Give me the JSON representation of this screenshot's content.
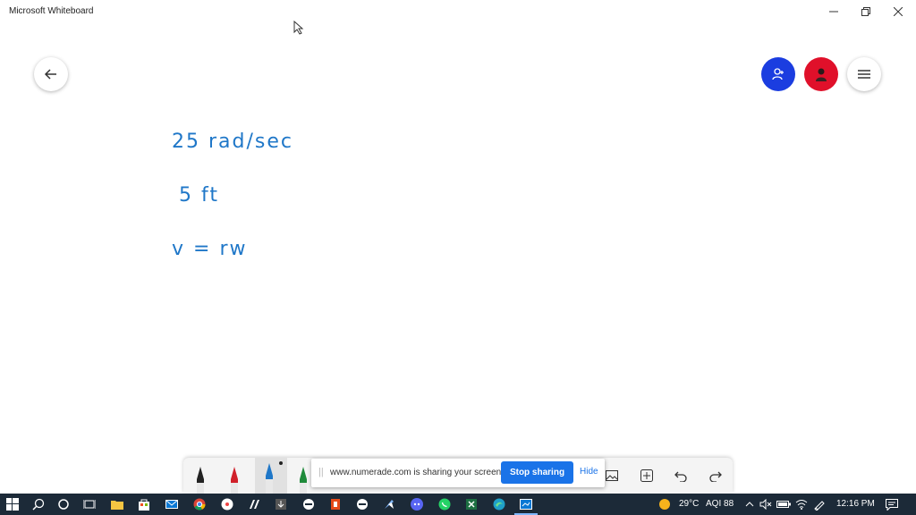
{
  "window": {
    "title": "Microsoft Whiteboard"
  },
  "whiteboard": {
    "ink_lines": [
      "25 rad/sec",
      "5 ft",
      "v = rw"
    ],
    "ink_color": "#1f77c8"
  },
  "top_buttons": {
    "invite_color": "#1b3de0",
    "avatar_color": "#e0102a"
  },
  "share_banner": {
    "message": "www.numerade.com is sharing your screen.",
    "stop_label": "Stop sharing",
    "hide_label": "Hide"
  },
  "taskbar": {
    "weather": "29°C",
    "aqi": "AQI 88",
    "time": "12:16 PM"
  }
}
